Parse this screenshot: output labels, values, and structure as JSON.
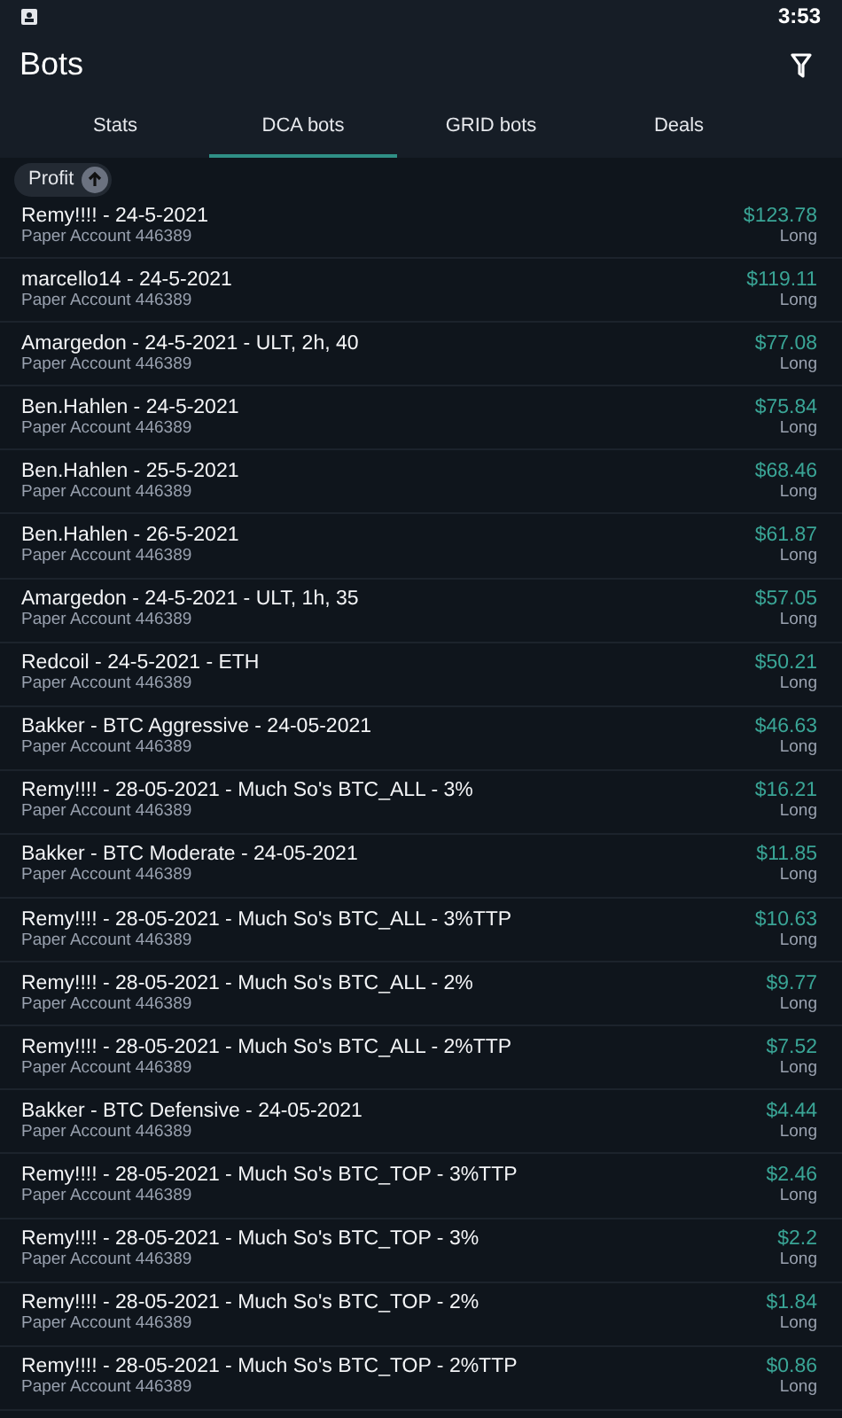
{
  "status_bar": {
    "time": "3:53"
  },
  "header": {
    "title": "Bots"
  },
  "tabs": [
    {
      "label": "Stats",
      "selected": false
    },
    {
      "label": "DCA bots",
      "selected": true
    },
    {
      "label": "GRID bots",
      "selected": false
    },
    {
      "label": "Deals",
      "selected": false
    }
  ],
  "sort_chip": {
    "label": "Profit"
  },
  "bots": [
    {
      "name": "Remy!!!! - 24-5-2021",
      "account": "Paper Account 446389",
      "profit": "$123.78",
      "side": "Long"
    },
    {
      "name": "marcello14 - 24-5-2021",
      "account": "Paper Account 446389",
      "profit": "$119.11",
      "side": "Long"
    },
    {
      "name": "Amargedon - 24-5-2021 - ULT, 2h, 40",
      "account": "Paper Account 446389",
      "profit": "$77.08",
      "side": "Long"
    },
    {
      "name": "Ben.Hahlen - 24-5-2021",
      "account": "Paper Account 446389",
      "profit": "$75.84",
      "side": "Long"
    },
    {
      "name": "Ben.Hahlen - 25-5-2021",
      "account": "Paper Account 446389",
      "profit": "$68.46",
      "side": "Long"
    },
    {
      "name": "Ben.Hahlen - 26-5-2021",
      "account": "Paper Account 446389",
      "profit": "$61.87",
      "side": "Long"
    },
    {
      "name": "Amargedon - 24-5-2021 - ULT, 1h, 35",
      "account": "Paper Account 446389",
      "profit": "$57.05",
      "side": "Long"
    },
    {
      "name": "Redcoil - 24-5-2021 - ETH",
      "account": "Paper Account 446389",
      "profit": "$50.21",
      "side": "Long"
    },
    {
      "name": "Bakker - BTC Aggressive - 24-05-2021",
      "account": "Paper Account 446389",
      "profit": "$46.63",
      "side": "Long"
    },
    {
      "name": "Remy!!!! - 28-05-2021 - Much So's BTC_ALL - 3%",
      "account": "Paper Account 446389",
      "profit": "$16.21",
      "side": "Long"
    },
    {
      "name": "Bakker - BTC Moderate - 24-05-2021",
      "account": "Paper Account 446389",
      "profit": "$11.85",
      "side": "Long"
    },
    {
      "name": "Remy!!!! - 28-05-2021 - Much So's BTC_ALL - 3%TTP",
      "account": "Paper Account 446389",
      "profit": "$10.63",
      "side": "Long"
    },
    {
      "name": "Remy!!!! - 28-05-2021 - Much So's BTC_ALL - 2%",
      "account": "Paper Account 446389",
      "profit": "$9.77",
      "side": "Long"
    },
    {
      "name": "Remy!!!! - 28-05-2021 - Much So's BTC_ALL - 2%TTP",
      "account": "Paper Account 446389",
      "profit": "$7.52",
      "side": "Long"
    },
    {
      "name": "Bakker - BTC Defensive - 24-05-2021",
      "account": "Paper Account 446389",
      "profit": "$4.44",
      "side": "Long"
    },
    {
      "name": "Remy!!!! - 28-05-2021 - Much So's BTC_TOP - 3%TTP",
      "account": "Paper Account 446389",
      "profit": "$2.46",
      "side": "Long"
    },
    {
      "name": "Remy!!!! - 28-05-2021 - Much So's BTC_TOP - 3%",
      "account": "Paper Account 446389",
      "profit": "$2.2",
      "side": "Long"
    },
    {
      "name": "Remy!!!! - 28-05-2021 - Much So's BTC_TOP - 2%",
      "account": "Paper Account 446389",
      "profit": "$1.84",
      "side": "Long"
    },
    {
      "name": "Remy!!!! - 28-05-2021 - Much So's BTC_TOP - 2%TTP",
      "account": "Paper Account 446389",
      "profit": "$0.86",
      "side": "Long"
    }
  ]
}
